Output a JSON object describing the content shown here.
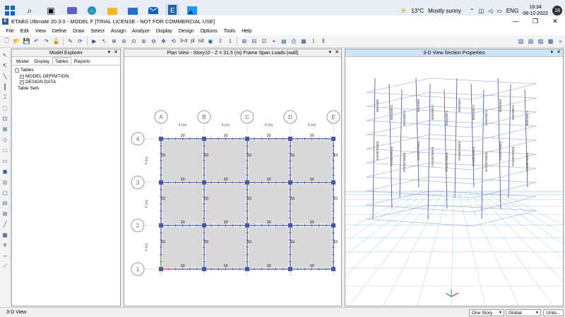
{
  "taskbar": {
    "temperature": "13°C",
    "weather": "Mostly sunny",
    "language": "ENG",
    "time": "18:34",
    "date": "08-12-2022",
    "notifications": "18"
  },
  "window": {
    "title": "ETABS Ultimate 20.3.0 - MODEL F  [TRIAL LICENSE - NOT FOR COMMERCIAL USE]"
  },
  "menu": [
    "File",
    "Edit",
    "View",
    "Define",
    "Draw",
    "Select",
    "Assign",
    "Analyze",
    "Display",
    "Design",
    "Options",
    "Tools",
    "Help"
  ],
  "toolbar": {
    "label_3d": "3-d",
    "label_pl": "pl",
    "label_nd": "nd"
  },
  "explorer": {
    "title": "Model Explorer",
    "tabs": [
      "Model",
      "Display",
      "Tables",
      "Reports"
    ],
    "tree": {
      "root": "Tables",
      "child1": "MODEL DEFINITION",
      "child2": "DESIGN DATA",
      "sets": "Table Sets"
    }
  },
  "plan": {
    "title": "Plan View - Story10 - Z = 31.5 (m)  Frame Span Loads (wall)",
    "columns": [
      "A",
      "B",
      "C",
      "D",
      "E"
    ],
    "rows": [
      "4",
      "3",
      "2",
      "1"
    ],
    "spacing_label": "4 (m)",
    "load_value": "10"
  },
  "view3d": {
    "title": "3-D View  Section Properties",
    "frame_label": "C400X600",
    "frame_label2": "600X600",
    "beam_label": "b300x450mm"
  },
  "status": {
    "text": "3-D View",
    "story": "One Story",
    "coord": "Global",
    "units": "Units..."
  }
}
